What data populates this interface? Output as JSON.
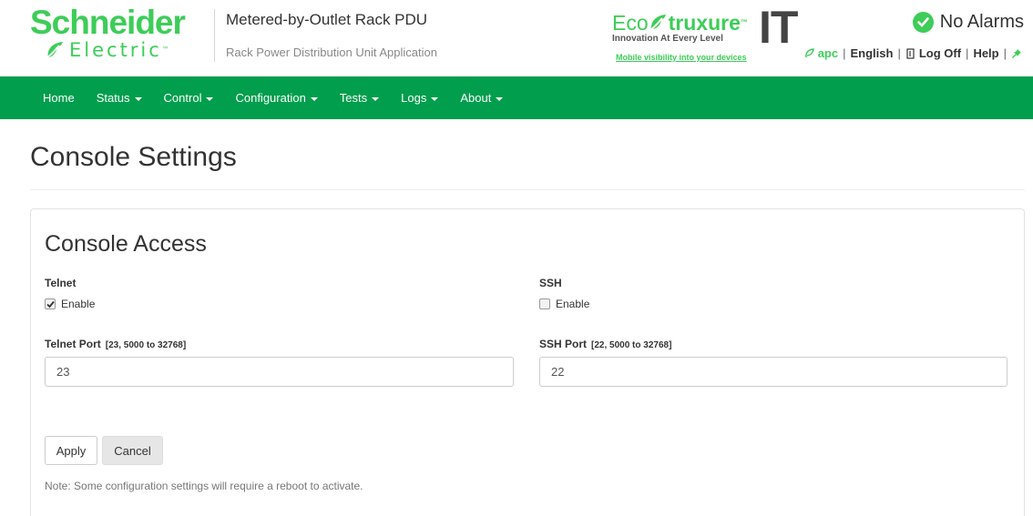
{
  "brand": {
    "name_top": "Schneider",
    "name_bottom": "Electric",
    "color": "#3dcd58"
  },
  "header": {
    "title": "Metered-by-Outlet Rack PDU",
    "subtitle": "Rack Power Distribution Unit Application"
  },
  "ecostruxure": {
    "eco": "Eco",
    "struxure": "truxure",
    "it": "IT",
    "tagline": "Innovation At Every Level",
    "link": "Mobile visibility into your devices"
  },
  "status": {
    "alarm_text": "No Alarms",
    "alarm_icon": "check-circle-icon"
  },
  "top_links": {
    "apc": "apc",
    "language": "English",
    "logoff": "Log Off",
    "help": "Help"
  },
  "nav": {
    "items": [
      "Home",
      "Status",
      "Control",
      "Configuration",
      "Tests",
      "Logs",
      "About"
    ],
    "background": "#009e4d"
  },
  "page": {
    "title": "Console Settings"
  },
  "console_access": {
    "title": "Console Access",
    "telnet": {
      "label": "Telnet",
      "enable_label": "Enable",
      "enabled": true,
      "port_label": "Telnet Port",
      "port_range": "[23, 5000 to 32768]",
      "port_value": "23"
    },
    "ssh": {
      "label": "SSH",
      "enable_label": "Enable",
      "enabled": false,
      "port_label": "SSH Port",
      "port_range": "[22, 5000 to 32768]",
      "port_value": "22"
    },
    "apply_label": "Apply",
    "cancel_label": "Cancel",
    "note": "Note: Some configuration settings will require a reboot to activate."
  }
}
